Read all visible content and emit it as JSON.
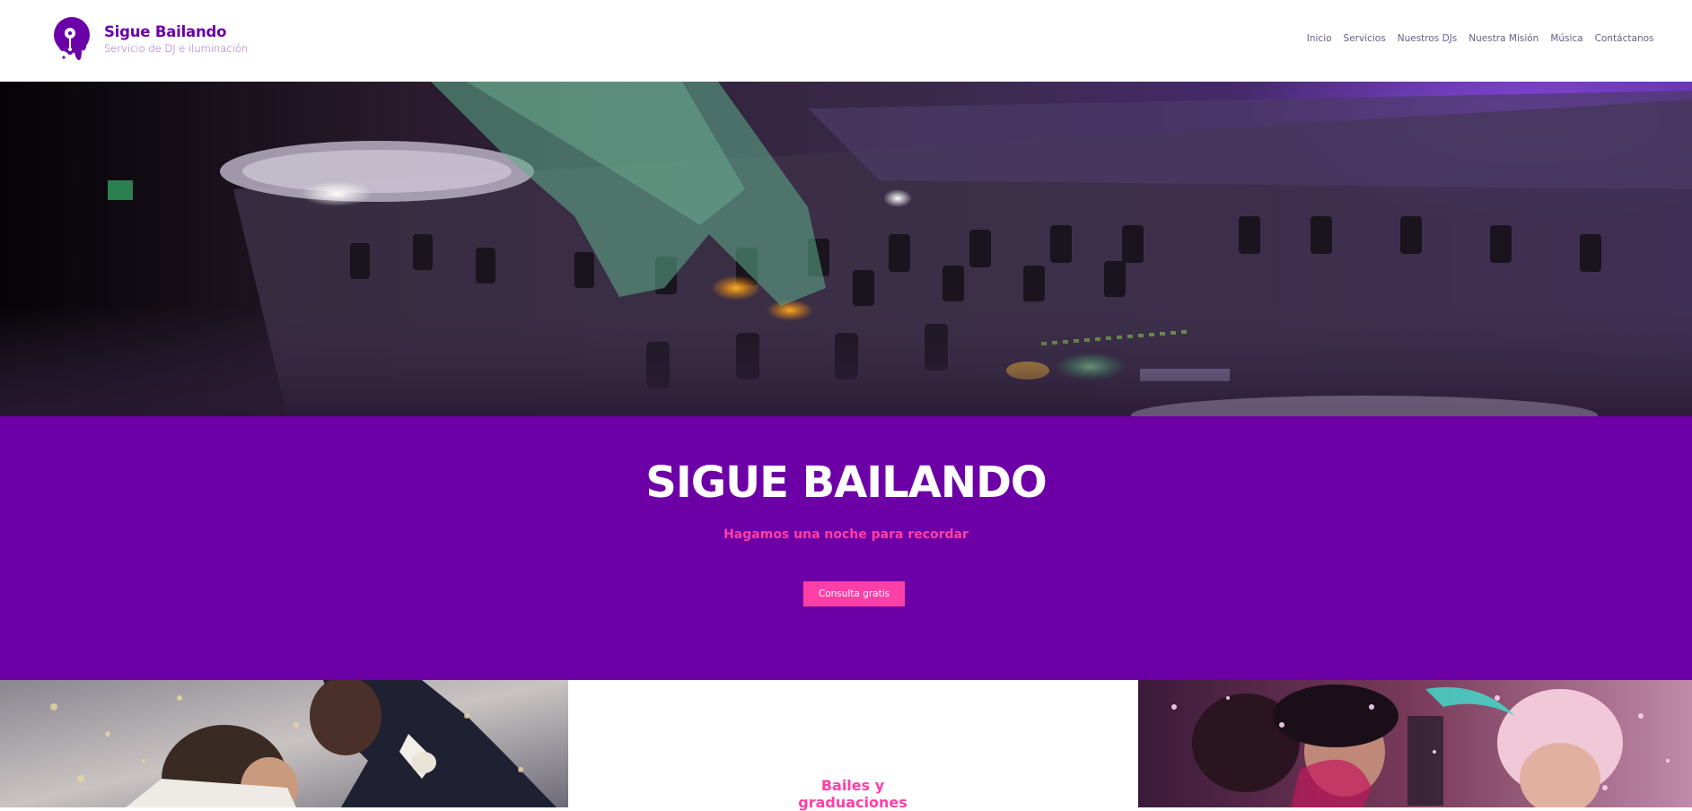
{
  "brand": {
    "name": "Sigue Bailando",
    "tagline": "Servicio de DJ e iluminación",
    "logo_icon": "vinyl-drip-icon",
    "color": "#6b00a8"
  },
  "nav": {
    "items": [
      {
        "label": "Inicio"
      },
      {
        "label": "Servicios"
      },
      {
        "label": "Nuestros DJs"
      },
      {
        "label": "Nuestra Misión"
      },
      {
        "label": "Música"
      },
      {
        "label": "Contáctanos"
      }
    ]
  },
  "hero": {
    "image": "dj-mixer-photo",
    "title": "SIGUE BAILANDO",
    "subtitle": "Hagamos una noche para recordar",
    "cta_label": "Consulta gratis",
    "band_color": "#6c00a6",
    "accent_color": "#ff3fa8"
  },
  "cards": {
    "left_image": "wedding-couple-photo",
    "center_title": "Bailes y graduaciones",
    "right_image": "party-confetti-photo"
  }
}
